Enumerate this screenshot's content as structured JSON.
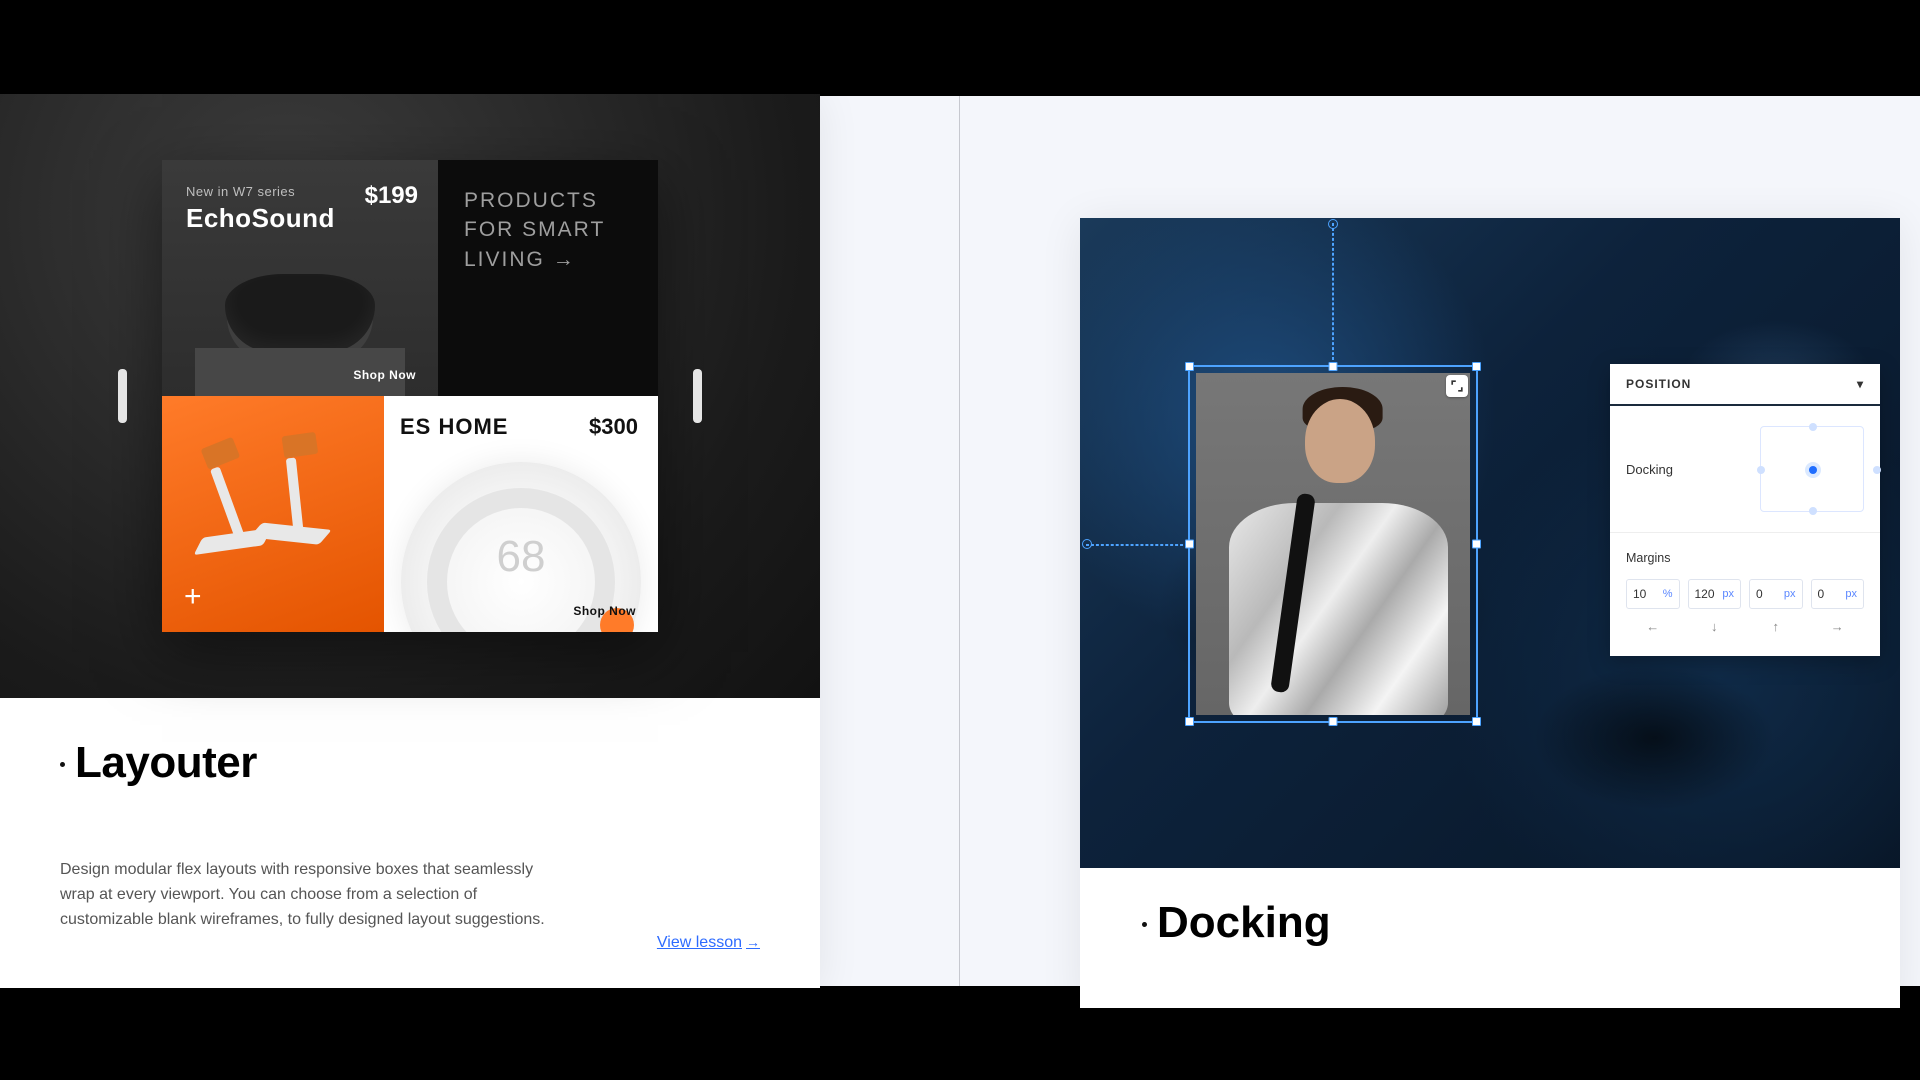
{
  "layouter": {
    "card_title": "Layouter",
    "description": "Design modular flex layouts with responsive boxes that seamlessly wrap at every viewport. You can choose from a selection of customizable blank wireframes, to fully designed layout suggestions.",
    "view_lesson": "View lesson",
    "arrow": "→",
    "carousel": {
      "tile_a": {
        "series": "New in W7 series",
        "name": "EchoSound",
        "price": "$199",
        "shop": "Shop Now"
      },
      "tile_b": "PRODUCTS FOR SMART LIVING →",
      "tile_c": {
        "plus": "+"
      },
      "tile_d": {
        "title": "ES HOME",
        "price": "$300",
        "temp": "68",
        "shop": "Shop Now"
      }
    }
  },
  "docking": {
    "card_title": "Docking",
    "panel": {
      "header": "POSITION",
      "docking_label": "Docking",
      "margins_label": "Margins",
      "margins": [
        {
          "v": "10",
          "u": "%"
        },
        {
          "v": "120",
          "u": "px"
        },
        {
          "v": "0",
          "u": "px"
        },
        {
          "v": "0",
          "u": "px"
        }
      ],
      "arrows": [
        "←",
        "↓",
        "↑",
        "→"
      ]
    }
  }
}
